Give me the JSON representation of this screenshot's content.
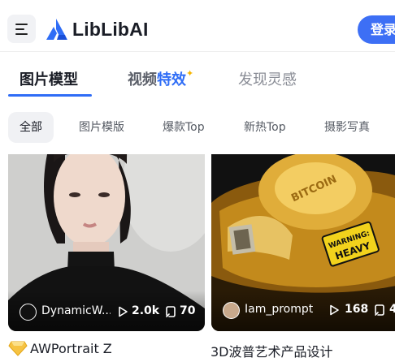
{
  "app": {
    "brand": "LibLibAI",
    "login_label": "登录",
    "accent": "#2f6df6"
  },
  "tabs": [
    {
      "label": "图片模型",
      "active": true
    },
    {
      "label_part1": "视频",
      "label_part2": "特效",
      "sparkle": "✦"
    },
    {
      "label": "发现灵感"
    }
  ],
  "chips": [
    {
      "label": "全部",
      "active": true
    },
    {
      "label": "图片模版"
    },
    {
      "label": "爆款Top"
    },
    {
      "label": "新热Top"
    },
    {
      "label": "摄影写真"
    }
  ],
  "cards": [
    {
      "author": "DynamicW...",
      "plays": "2.0k",
      "remixes": "70",
      "title": "AWPortrait Z"
    },
    {
      "author": "Iam_prompt",
      "plays": "168",
      "remixes": "4",
      "title": "3D波普艺术产品设计",
      "image_text": {
        "coin": "BITCOIN",
        "badge_line1": "WARNING:",
        "badge_line2": "HEAVY"
      }
    }
  ]
}
